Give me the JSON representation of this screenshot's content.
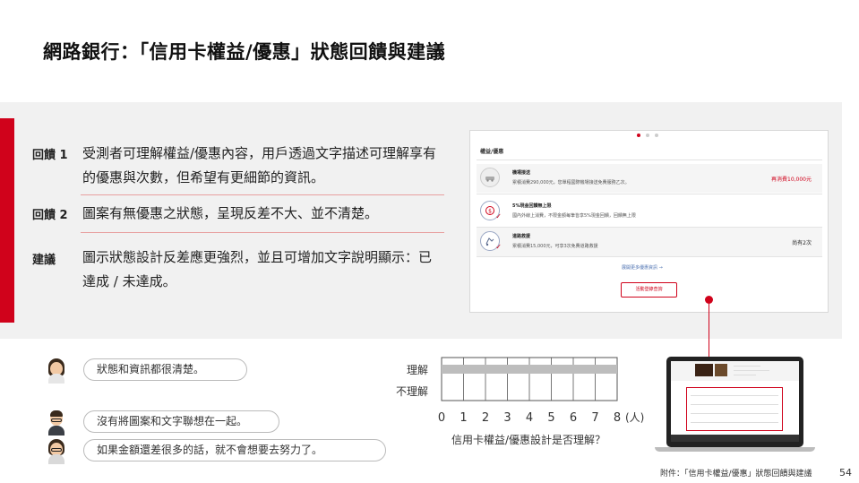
{
  "title": "網路銀行：「信用卡權益/優惠」狀態回饋與建議",
  "feedback": [
    {
      "label": "回饋 1",
      "text": "受測者可理解權益/優惠內容，用戶透過文字描述可理解享有的優惠與次數，但希望有更細節的資訊。"
    },
    {
      "label": "回饋 2",
      "text": "圖案有無優惠之狀態，呈現反差不大、並不清楚。"
    },
    {
      "label": "建議",
      "text": "圖示狀態設計反差應更強烈，並且可增加文字說明顯示：已達成 / 未達成。"
    }
  ],
  "mock": {
    "header": "權益/優惠",
    "rows": [
      {
        "title": "機場接送",
        "desc": "累積消費290,000元，您單程國際機場接送免費服務乙次。",
        "right": "再消費10,000元",
        "right_color": "#d0021b",
        "icon": "car-icon"
      },
      {
        "title": "5%現金回饋無上限",
        "desc": "國內外線上消費，不限金額每筆皆享5%現金回饋，回饋無上限",
        "right": "",
        "right_color": "#333333",
        "icon": "cashback-icon"
      },
      {
        "title": "道路救援",
        "desc": "累積消費15,000元，可享3次免費道路救援",
        "right": "尚有2次",
        "right_color": "#333333",
        "icon": "roadside-icon"
      }
    ],
    "more_link": "展開更多優惠資訊 →",
    "button": "活動登錄查詢"
  },
  "comments": [
    {
      "text": "狀態和資訊都很清楚。",
      "avatar": "woman-avatar"
    },
    {
      "text": "沒有將圖案和文字聯想在一起。",
      "avatar": "man-glasses-avatar"
    },
    {
      "text": "如果金額還差很多的話，就不會想要去努力了。",
      "avatar": "woman-glasses-avatar"
    }
  ],
  "chart_data": {
    "type": "bar",
    "orientation": "horizontal",
    "categories": [
      "理解",
      "不理解"
    ],
    "values": [
      8,
      0
    ],
    "xlim": [
      0,
      8
    ],
    "xticks": [
      0,
      1,
      2,
      3,
      4,
      5,
      6,
      7,
      8
    ],
    "xunit": "(人)",
    "xlabel": "信用卡權益/優惠設計是否理解？",
    "bar_color": "#bdbdbd"
  },
  "laptop_icon": "laptop-icon",
  "footer": {
    "note": "附件：「信用卡權益/優惠」狀態回饋與建議",
    "page": "54"
  },
  "colors": {
    "accent": "#d0021b",
    "panel": "#f1f1f1"
  }
}
